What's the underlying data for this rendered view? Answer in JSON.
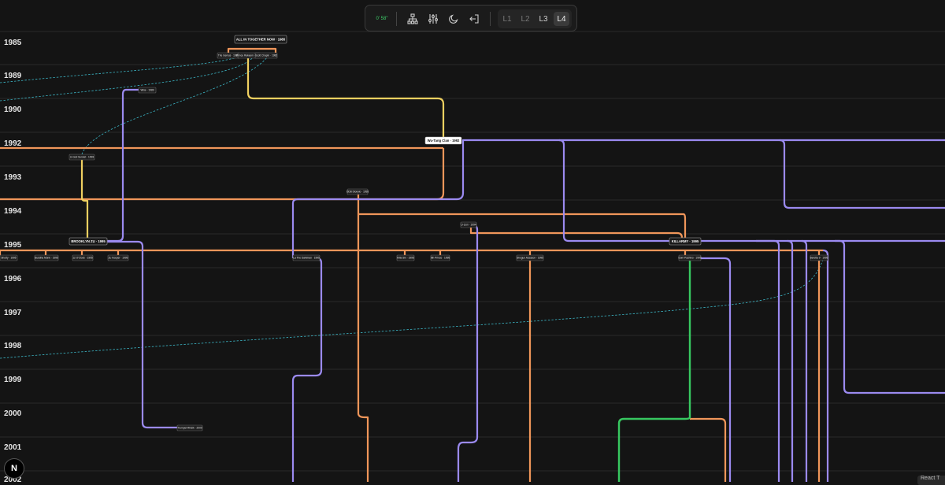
{
  "toolbar": {
    "time": "0' 58\"",
    "icons": [
      "hierarchy-icon",
      "sliders-icon",
      "moon-icon",
      "exit-icon"
    ],
    "levels": [
      {
        "label": "L1",
        "active": false
      },
      {
        "label": "L2",
        "active": false
      },
      {
        "label": "L3",
        "active": false
      },
      {
        "label": "L4",
        "active": true
      }
    ]
  },
  "years": [
    "1985",
    "1989",
    "1990",
    "1992",
    "1993",
    "1994",
    "1995",
    "1996",
    "1997",
    "1998",
    "1999",
    "2000",
    "2001",
    "2002"
  ],
  "albums": [
    {
      "label": "ALL IN TOGETHER NOW · 1985",
      "highlight": false
    },
    {
      "label": "Wu-Tang Clan · 1992",
      "highlight": true
    },
    {
      "label": "BROOKLYN ZU · 1995",
      "highlight": false
    },
    {
      "label": "KILLARMY · 1995",
      "highlight": false
    }
  ],
  "members": [
    "The Genius · 1985",
    "Prince Rakeem · 1985",
    "Scott Chapin · 1985",
    "Wise · 1989",
    "U-God Sunnet · 1993",
    "ODB Dionyio · 1993",
    "U-Lion · 1994",
    "Shorty · 1995",
    "Buddha Monk · 1995",
    "12 O'Clock · 1995",
    "Zu Keeper · 1995",
    "La The Darkman · 1995",
    "Killa Sin · 1995",
    "9th Prince · 1995",
    "Shogun Assason · 1995",
    "Dom Pachino · 1995",
    "Beretta 9 · 1995",
    "Trumpet Rhizik · 2000"
  ],
  "colors": {
    "orange": "#f0965a",
    "purple": "#9b8af0",
    "yellow": "#f0d060",
    "green": "#37c860",
    "cyan": "#3cb8c8",
    "background": "#141414"
  },
  "footer": {
    "logo": "N",
    "badge": "React T"
  }
}
